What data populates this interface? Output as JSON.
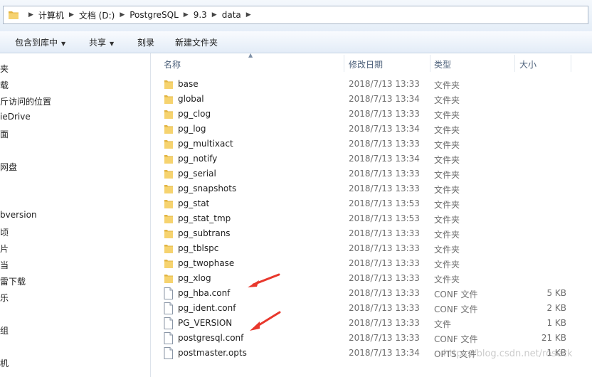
{
  "address_bar": {
    "crumbs": [
      "计算机",
      "文档 (D:)",
      "PostgreSQL",
      "9.3",
      "data"
    ]
  },
  "toolbar": {
    "include_in_library": "包含到库中",
    "share": "共享",
    "burn": "刻录",
    "new_folder": "新建文件夹"
  },
  "nav_items": [
    "夹",
    "载",
    "斤访问的位置",
    "ieDrive",
    "面",
    "网盘",
    "bversion",
    "顷",
    "片",
    "当",
    "雷下载",
    "乐",
    "组",
    "机"
  ],
  "columns": {
    "name": "名称",
    "modified": "修改日期",
    "type": "类型",
    "size": "大小"
  },
  "files": [
    {
      "name": "base",
      "date": "2018/7/13 13:33",
      "type": "文件夹",
      "size": "",
      "icon": "folder-icon"
    },
    {
      "name": "global",
      "date": "2018/7/13 13:34",
      "type": "文件夹",
      "size": "",
      "icon": "folder-icon"
    },
    {
      "name": "pg_clog",
      "date": "2018/7/13 13:33",
      "type": "文件夹",
      "size": "",
      "icon": "folder-icon"
    },
    {
      "name": "pg_log",
      "date": "2018/7/13 13:34",
      "type": "文件夹",
      "size": "",
      "icon": "folder-icon"
    },
    {
      "name": "pg_multixact",
      "date": "2018/7/13 13:33",
      "type": "文件夹",
      "size": "",
      "icon": "folder-icon"
    },
    {
      "name": "pg_notify",
      "date": "2018/7/13 13:34",
      "type": "文件夹",
      "size": "",
      "icon": "folder-icon"
    },
    {
      "name": "pg_serial",
      "date": "2018/7/13 13:33",
      "type": "文件夹",
      "size": "",
      "icon": "folder-icon"
    },
    {
      "name": "pg_snapshots",
      "date": "2018/7/13 13:33",
      "type": "文件夹",
      "size": "",
      "icon": "folder-icon"
    },
    {
      "name": "pg_stat",
      "date": "2018/7/13 13:53",
      "type": "文件夹",
      "size": "",
      "icon": "folder-icon"
    },
    {
      "name": "pg_stat_tmp",
      "date": "2018/7/13 13:53",
      "type": "文件夹",
      "size": "",
      "icon": "folder-icon"
    },
    {
      "name": "pg_subtrans",
      "date": "2018/7/13 13:33",
      "type": "文件夹",
      "size": "",
      "icon": "folder-icon"
    },
    {
      "name": "pg_tblspc",
      "date": "2018/7/13 13:33",
      "type": "文件夹",
      "size": "",
      "icon": "folder-icon"
    },
    {
      "name": "pg_twophase",
      "date": "2018/7/13 13:33",
      "type": "文件夹",
      "size": "",
      "icon": "folder-icon"
    },
    {
      "name": "pg_xlog",
      "date": "2018/7/13 13:33",
      "type": "文件夹",
      "size": "",
      "icon": "folder-icon"
    },
    {
      "name": "pg_hba.conf",
      "date": "2018/7/13 13:33",
      "type": "CONF 文件",
      "size": "5 KB",
      "icon": "file-icon"
    },
    {
      "name": "pg_ident.conf",
      "date": "2018/7/13 13:33",
      "type": "CONF 文件",
      "size": "2 KB",
      "icon": "file-icon"
    },
    {
      "name": "PG_VERSION",
      "date": "2018/7/13 13:33",
      "type": "文件",
      "size": "1 KB",
      "icon": "file-icon"
    },
    {
      "name": "postgresql.conf",
      "date": "2018/7/13 13:33",
      "type": "CONF 文件",
      "size": "21 KB",
      "icon": "file-icon"
    },
    {
      "name": "postmaster.opts",
      "date": "2018/7/13 13:34",
      "type": "OPTS 文件",
      "size": "1 KB",
      "icon": "file-icon"
    }
  ],
  "watermark": "https://blog.csdn.net/roseck",
  "colors": {
    "annotation_arrow": "#e8372c",
    "folder": "#f2c75c",
    "header_text": "#4c607a"
  }
}
